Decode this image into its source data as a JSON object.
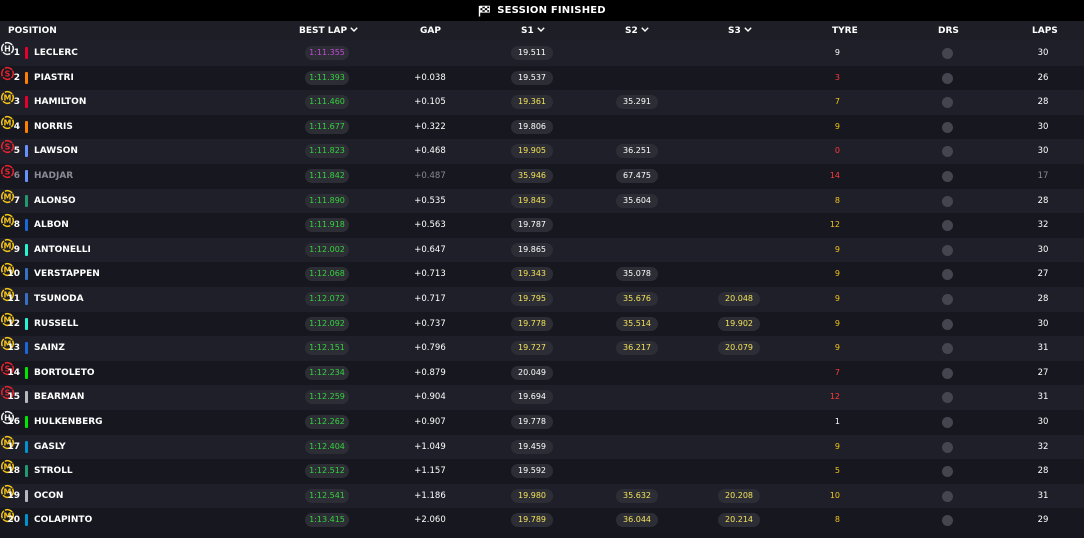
{
  "banner": {
    "title": "SESSION FINISHED",
    "icon": "checkered-flag-icon"
  },
  "header": {
    "position": "POSITION",
    "best_lap": "BEST LAP",
    "gap": "GAP",
    "s1": "S1",
    "s2": "S2",
    "s3": "S3",
    "tyre": "TYRE",
    "drs": "DRS",
    "laps": "LAPS"
  },
  "colors": {
    "purple": "#c24ad6",
    "green": "#35d23d",
    "yellow": "#f2e35a",
    "white": "#ffffff",
    "soft": "#e8232e",
    "medium": "#f5c518",
    "hard": "#f0f0f0",
    "tyre_life_red": "#ff3b3b",
    "tyre_life_yellow": "#f5c518",
    "tyre_life_white": "#ffffff"
  },
  "rows": [
    {
      "pos": "1",
      "driver": "LECLERC",
      "team_color": "#e8002d",
      "best": "1:11.355",
      "best_c": "purple",
      "gap": "",
      "s1": "19.511",
      "s1_c": "white",
      "s2": "",
      "s2_c": "",
      "s3": "",
      "s3_c": "",
      "tyre": "H",
      "tyre_life": "9",
      "laps": "30"
    },
    {
      "pos": "2",
      "driver": "PIASTRI",
      "team_color": "#ff8000",
      "best": "1:11.393",
      "best_c": "green",
      "gap": "+0.038",
      "s1": "19.537",
      "s1_c": "white",
      "s2": "",
      "s2_c": "",
      "s3": "",
      "s3_c": "",
      "tyre": "S",
      "tyre_life": "3",
      "laps": "26"
    },
    {
      "pos": "3",
      "driver": "HAMILTON",
      "team_color": "#e8002d",
      "best": "1:11.460",
      "best_c": "green",
      "gap": "+0.105",
      "s1": "19.361",
      "s1_c": "yellow",
      "s2": "35.291",
      "s2_c": "white",
      "s3": "",
      "s3_c": "",
      "tyre": "M",
      "tyre_life": "7",
      "laps": "28"
    },
    {
      "pos": "4",
      "driver": "NORRIS",
      "team_color": "#ff8000",
      "best": "1:11.677",
      "best_c": "green",
      "gap": "+0.322",
      "s1": "19.806",
      "s1_c": "white",
      "s2": "",
      "s2_c": "",
      "s3": "",
      "s3_c": "",
      "tyre": "M",
      "tyre_life": "9",
      "laps": "30"
    },
    {
      "pos": "5",
      "driver": "LAWSON",
      "team_color": "#6692ff",
      "best": "1:11.823",
      "best_c": "green",
      "gap": "+0.468",
      "s1": "19.905",
      "s1_c": "yellow",
      "s2": "36.251",
      "s2_c": "white",
      "s3": "",
      "s3_c": "",
      "tyre": "S",
      "tyre_life": "0",
      "laps": "30"
    },
    {
      "pos": "6",
      "driver": "HADJAR",
      "team_color": "#6692ff",
      "best": "1:11.842",
      "best_c": "green",
      "gap": "+0.487",
      "s1": "35.946",
      "s1_c": "yellow",
      "s2": "67.475",
      "s2_c": "white",
      "s3": "",
      "s3_c": "",
      "tyre": "S",
      "tyre_life": "14",
      "laps": "17",
      "dim": true
    },
    {
      "pos": "7",
      "driver": "ALONSO",
      "team_color": "#229971",
      "best": "1:11.890",
      "best_c": "green",
      "gap": "+0.535",
      "s1": "19.845",
      "s1_c": "yellow",
      "s2": "35.604",
      "s2_c": "white",
      "s3": "",
      "s3_c": "",
      "tyre": "M",
      "tyre_life": "8",
      "laps": "28"
    },
    {
      "pos": "8",
      "driver": "ALBON",
      "team_color": "#1868db",
      "best": "1:11.918",
      "best_c": "green",
      "gap": "+0.563",
      "s1": "19.787",
      "s1_c": "white",
      "s2": "",
      "s2_c": "",
      "s3": "",
      "s3_c": "",
      "tyre": "M",
      "tyre_life": "12",
      "laps": "32"
    },
    {
      "pos": "9",
      "driver": "ANTONELLI",
      "team_color": "#27f4d2",
      "best": "1:12.002",
      "best_c": "green",
      "gap": "+0.647",
      "s1": "19.865",
      "s1_c": "white",
      "s2": "",
      "s2_c": "",
      "s3": "",
      "s3_c": "",
      "tyre": "M",
      "tyre_life": "9",
      "laps": "30"
    },
    {
      "pos": "10",
      "driver": "VERSTAPPEN",
      "team_color": "#3671c6",
      "best": "1:12.068",
      "best_c": "green",
      "gap": "+0.713",
      "s1": "19.343",
      "s1_c": "yellow",
      "s2": "35.078",
      "s2_c": "white",
      "s3": "",
      "s3_c": "",
      "tyre": "M",
      "tyre_life": "9",
      "laps": "27"
    },
    {
      "pos": "11",
      "driver": "TSUNODA",
      "team_color": "#3671c6",
      "best": "1:12.072",
      "best_c": "green",
      "gap": "+0.717",
      "s1": "19.795",
      "s1_c": "yellow",
      "s2": "35.676",
      "s2_c": "yellow",
      "s3": "20.048",
      "s3_c": "yellow",
      "tyre": "M",
      "tyre_life": "9",
      "laps": "28"
    },
    {
      "pos": "12",
      "driver": "RUSSELL",
      "team_color": "#27f4d2",
      "best": "1:12.092",
      "best_c": "green",
      "gap": "+0.737",
      "s1": "19.778",
      "s1_c": "yellow",
      "s2": "35.514",
      "s2_c": "yellow",
      "s3": "19.902",
      "s3_c": "yellow",
      "tyre": "M",
      "tyre_life": "9",
      "laps": "30"
    },
    {
      "pos": "13",
      "driver": "SAINZ",
      "team_color": "#1868db",
      "best": "1:12.151",
      "best_c": "green",
      "gap": "+0.796",
      "s1": "19.727",
      "s1_c": "yellow",
      "s2": "36.217",
      "s2_c": "yellow",
      "s3": "20.079",
      "s3_c": "yellow",
      "tyre": "M",
      "tyre_life": "9",
      "laps": "31"
    },
    {
      "pos": "14",
      "driver": "BORTOLETO",
      "team_color": "#00e700",
      "best": "1:12.234",
      "best_c": "green",
      "gap": "+0.879",
      "s1": "20.049",
      "s1_c": "white",
      "s2": "",
      "s2_c": "",
      "s3": "",
      "s3_c": "",
      "tyre": "S",
      "tyre_life": "7",
      "laps": "27"
    },
    {
      "pos": "15",
      "driver": "BEARMAN",
      "team_color": "#b6babd",
      "best": "1:12.259",
      "best_c": "green",
      "gap": "+0.904",
      "s1": "19.694",
      "s1_c": "white",
      "s2": "",
      "s2_c": "",
      "s3": "",
      "s3_c": "",
      "tyre": "S",
      "tyre_life": "12",
      "laps": "31"
    },
    {
      "pos": "16",
      "driver": "HULKENBERG",
      "team_color": "#00e700",
      "best": "1:12.262",
      "best_c": "green",
      "gap": "+0.907",
      "s1": "19.778",
      "s1_c": "white",
      "s2": "",
      "s2_c": "",
      "s3": "",
      "s3_c": "",
      "tyre": "H",
      "tyre_life": "1",
      "laps": "30"
    },
    {
      "pos": "17",
      "driver": "GASLY",
      "team_color": "#0093cc",
      "best": "1:12.404",
      "best_c": "green",
      "gap": "+1.049",
      "s1": "19.459",
      "s1_c": "white",
      "s2": "",
      "s2_c": "",
      "s3": "",
      "s3_c": "",
      "tyre": "M",
      "tyre_life": "9",
      "laps": "32"
    },
    {
      "pos": "18",
      "driver": "STROLL",
      "team_color": "#229971",
      "best": "1:12.512",
      "best_c": "green",
      "gap": "+1.157",
      "s1": "19.592",
      "s1_c": "white",
      "s2": "",
      "s2_c": "",
      "s3": "",
      "s3_c": "",
      "tyre": "M",
      "tyre_life": "5",
      "laps": "28"
    },
    {
      "pos": "19",
      "driver": "OCON",
      "team_color": "#b6babd",
      "best": "1:12.541",
      "best_c": "green",
      "gap": "+1.186",
      "s1": "19.980",
      "s1_c": "yellow",
      "s2": "35.632",
      "s2_c": "yellow",
      "s3": "20.208",
      "s3_c": "yellow",
      "tyre": "M",
      "tyre_life": "10",
      "laps": "31"
    },
    {
      "pos": "20",
      "driver": "COLAPINTO",
      "team_color": "#0093cc",
      "best": "1:13.415",
      "best_c": "green",
      "gap": "+2.060",
      "s1": "19.789",
      "s1_c": "yellow",
      "s2": "36.044",
      "s2_c": "yellow",
      "s3": "20.214",
      "s3_c": "yellow",
      "tyre": "M",
      "tyre_life": "8",
      "laps": "29"
    }
  ]
}
